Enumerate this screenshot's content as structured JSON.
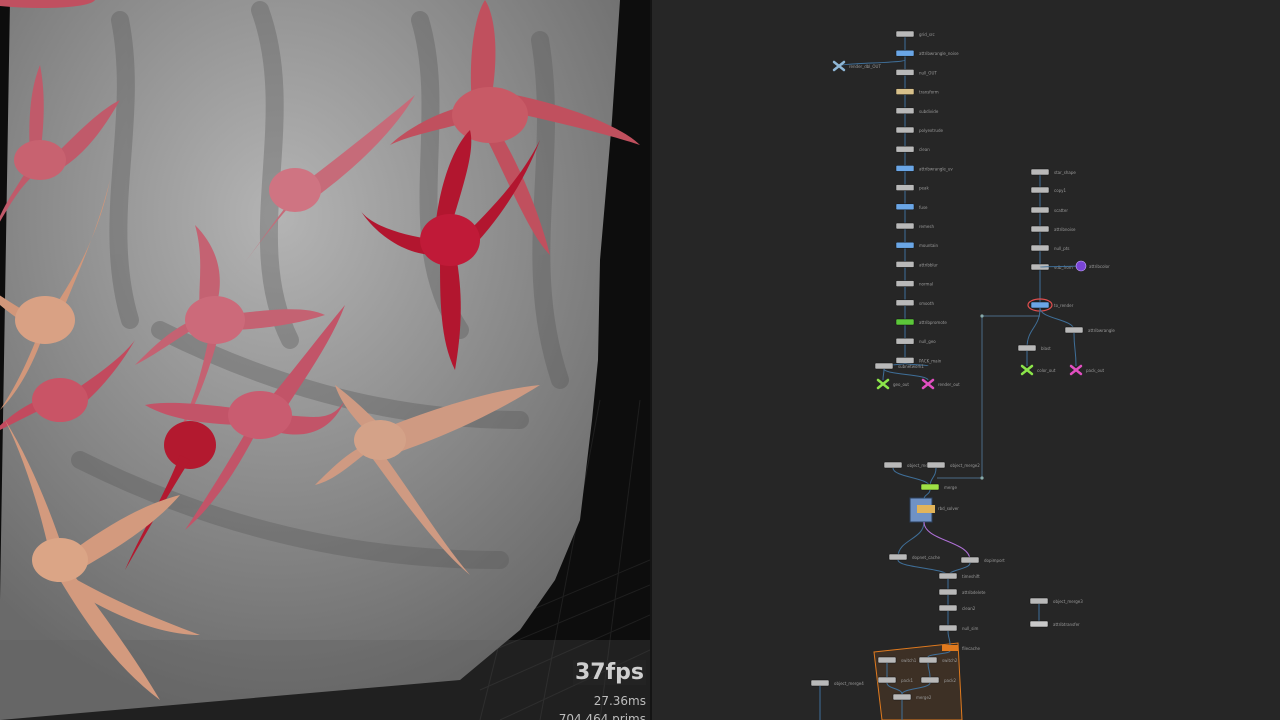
{
  "viewport": {
    "fps": "37fps",
    "frame_time": "27.36ms",
    "stats": "704,464  prims"
  },
  "network": {
    "nodes_main": [
      "grid_src",
      "attribwrangle_noise",
      "null_OUT",
      "transform",
      "subdivide",
      "polyextrude",
      "clean",
      "attribwrangle_uv",
      "peak",
      "fuse",
      "remesh",
      "mountain",
      "attribblur",
      "normal",
      "smooth",
      "attribpromote",
      "null_geo",
      "PACK_main"
    ],
    "outputs": [
      "geo_out",
      "render_out"
    ],
    "nodes_right": [
      "star_shape",
      "copy1",
      "scatter",
      "attribnoise",
      "null_pts",
      "vdb_from",
      "to_render"
    ],
    "outputs_right": [
      "color_out",
      "pack_out"
    ],
    "bottom_nodes": [
      "merge",
      "rbd_solver",
      "dopnet_cache",
      "dopimport",
      "timeshift",
      "null_sim",
      "filecache"
    ]
  }
}
